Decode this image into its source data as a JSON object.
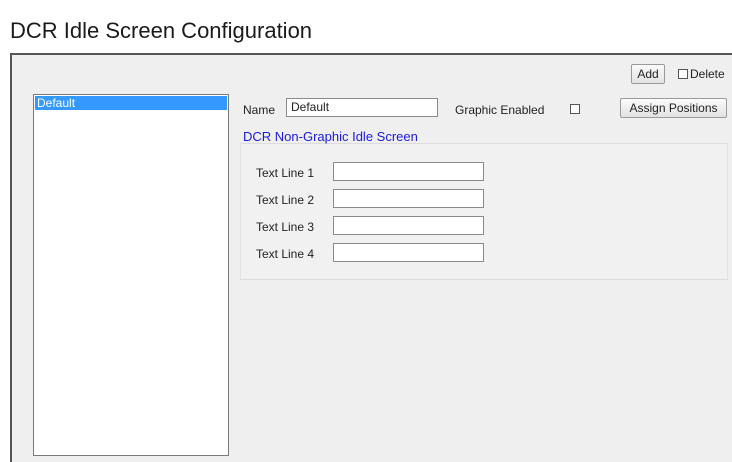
{
  "page": {
    "title": "DCR Idle Screen Configuration"
  },
  "toolbar": {
    "add_label": "Add",
    "delete_label": "Delete",
    "delete_checked": false
  },
  "list": {
    "items": [
      {
        "label": "Default",
        "selected": true
      }
    ]
  },
  "form": {
    "name_label": "Name",
    "name_value": "Default",
    "graphic_enabled_label": "Graphic Enabled",
    "graphic_enabled_checked": false,
    "assign_positions_label": "Assign Positions"
  },
  "non_graphic": {
    "title": "DCR Non-Graphic Idle Screen",
    "lines": [
      {
        "label": "Text Line 1",
        "value": ""
      },
      {
        "label": "Text Line 2",
        "value": ""
      },
      {
        "label": "Text Line 3",
        "value": ""
      },
      {
        "label": "Text Line 4",
        "value": ""
      }
    ]
  },
  "colors": {
    "selection": "#3399ff",
    "section_title": "#1a1adb",
    "panel_bg": "#efefef"
  }
}
